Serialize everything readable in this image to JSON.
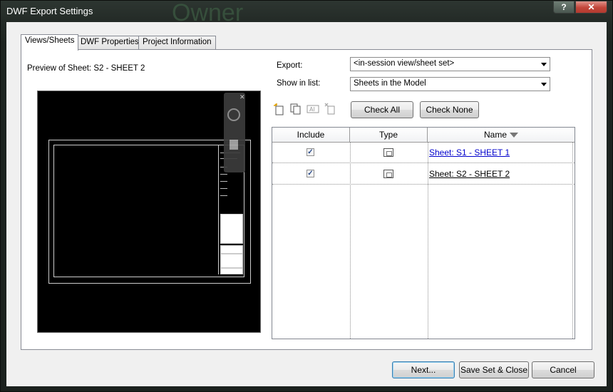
{
  "window": {
    "title": "DWF Export Settings",
    "background_text": "Owner",
    "help_label": "?",
    "close_label": "✕"
  },
  "tabs": [
    {
      "label": "Views/Sheets",
      "active": true
    },
    {
      "label": "DWF Properties",
      "active": false
    },
    {
      "label": "Project Information",
      "active": false
    }
  ],
  "preview": {
    "label": "Preview of Sheet: S2 - SHEET 2",
    "close_glyph": "✕"
  },
  "export": {
    "label": "Export:",
    "value": "<in-session view/sheet set>"
  },
  "show_in_list": {
    "label": "Show in list:",
    "value": "Sheets in the Model"
  },
  "toolbar": {
    "icons": [
      "new-set-icon",
      "duplicate-icon",
      "rename-icon",
      "delete-icon"
    ],
    "check_all": "Check All",
    "check_none": "Check None"
  },
  "table": {
    "columns": [
      "Include",
      "Type",
      "Name"
    ],
    "rows": [
      {
        "include": true,
        "type": "sheet-icon",
        "name": "Sheet: S1 - SHEET 1"
      },
      {
        "include": true,
        "type": "sheet-icon",
        "name": "Sheet: S2 - SHEET 2"
      }
    ]
  },
  "footer": {
    "next": "Next...",
    "save_set_close": "Save Set & Close",
    "cancel": "Cancel"
  },
  "colors": {
    "link": "#0000cc",
    "close_button": "#c2463a",
    "default_button_border": "#3c7fb1"
  }
}
